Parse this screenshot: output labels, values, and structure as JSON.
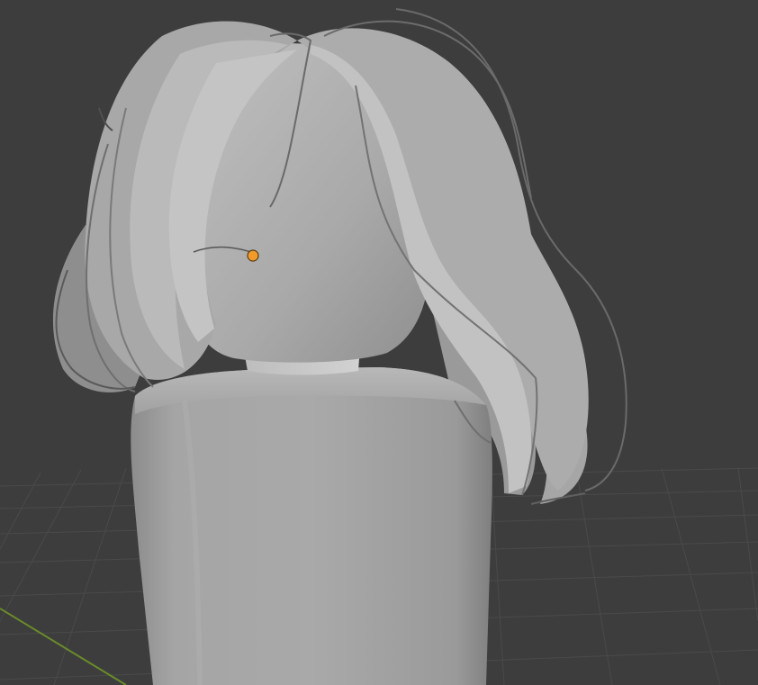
{
  "viewport": {
    "background": "#3d3d3d",
    "grid_color": "#4a4a4a",
    "x_axis_color": "#6a8a2a"
  },
  "scene": {
    "model": "avatar-with-hair",
    "mesh_base_color": "#9c9c9c",
    "hair_color": "#b0b0b0",
    "origin_color": "#f19b2c",
    "origin_outline_color": "#5a3a10"
  }
}
